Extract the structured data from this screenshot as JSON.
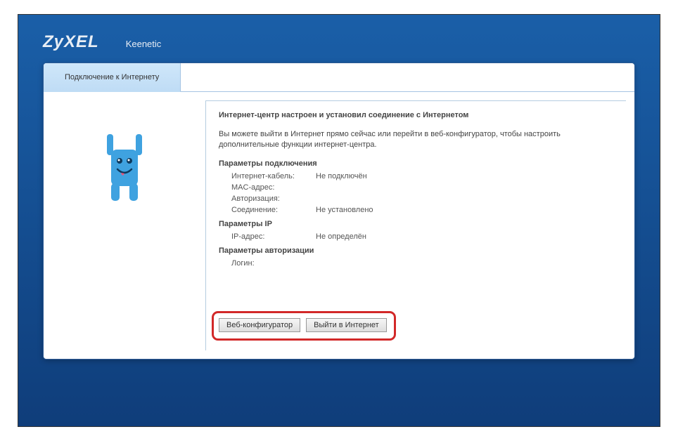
{
  "header": {
    "brand": "ZyXEL",
    "model": "Keenetic"
  },
  "tab": {
    "label": "Подключение к Интернету"
  },
  "content": {
    "title": "Интернет-центр настроен и установил соединение с Интернетом",
    "desc": "Вы можете выйти в Интернет прямо сейчас или перейти в веб-конфигуратор, чтобы настроить дополнительные функции интернет-центра.",
    "sections": {
      "conn_title": "Параметры подключения",
      "conn": {
        "cable_label": "Интернет-кабель:",
        "cable_value": "Не подключён",
        "mac_label": "MAC-адрес:",
        "mac_value": " ",
        "auth_label": "Авторизация:",
        "auth_value": " ",
        "conn_label": "Соединение:",
        "conn_value": "Не установлено"
      },
      "ip_title": "Параметры IP",
      "ip": {
        "ip_label": "IP-адрес:",
        "ip_value": "Не определён"
      },
      "authp_title": "Параметры авторизации",
      "authp": {
        "login_label": "Логин:",
        "login_value": " "
      }
    },
    "buttons": {
      "webconf": "Веб-конфигуратор",
      "gointernet": "Выйти в Интернет"
    }
  }
}
